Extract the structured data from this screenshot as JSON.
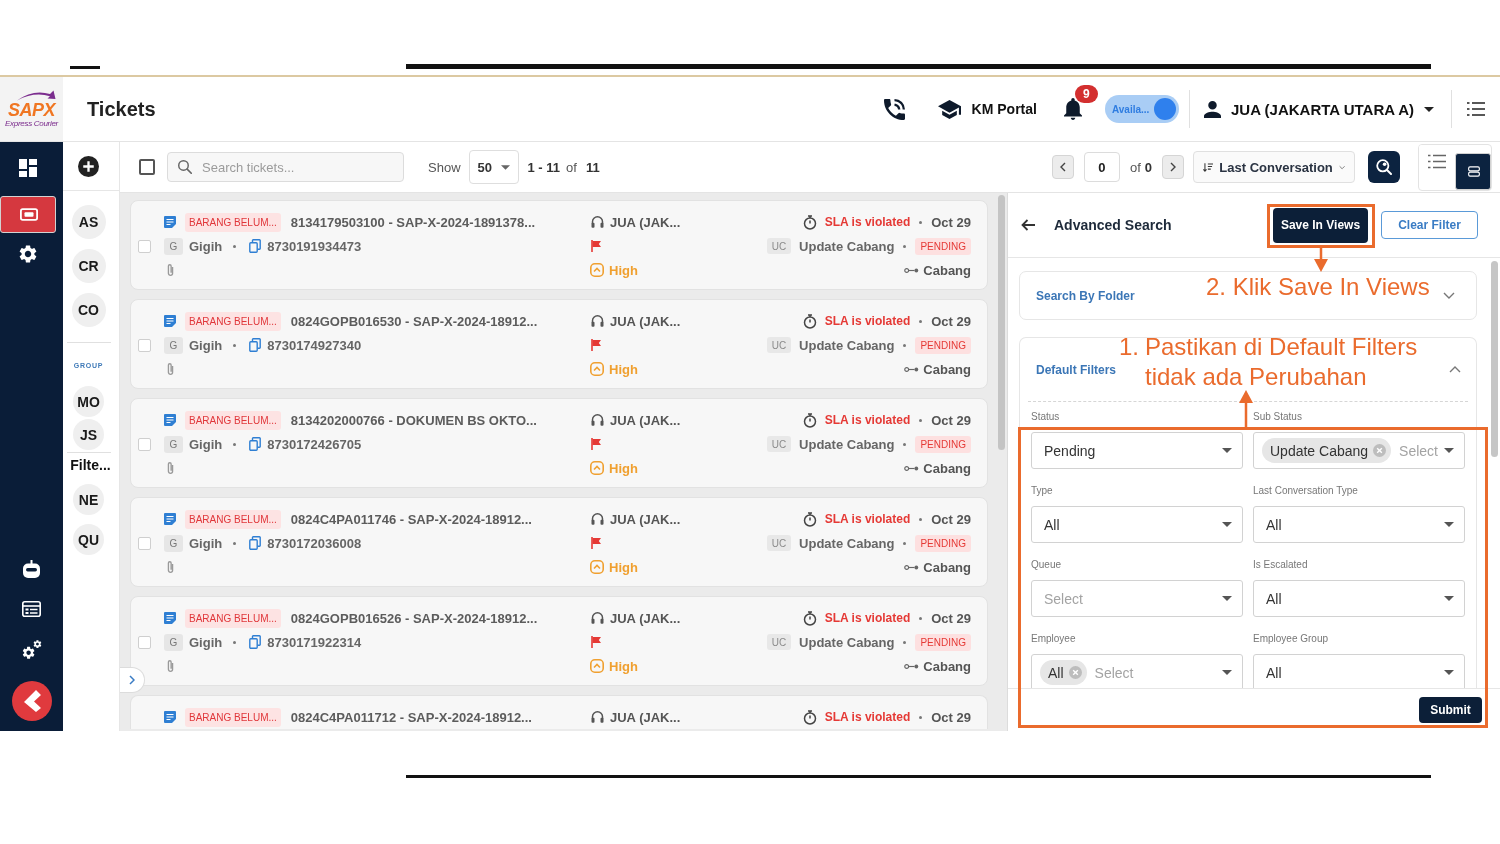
{
  "logo": {
    "name": "SAPX",
    "tagline": "Express Courier"
  },
  "header": {
    "title": "Tickets",
    "km_portal": "KM Portal",
    "notification_count": "9",
    "availability": {
      "label": "Availa...",
      "on": true
    },
    "user": "JUA (JAKARTA UTARA A)"
  },
  "nav": [
    {
      "selected": false
    },
    {
      "selected": true
    },
    {
      "selected": false
    }
  ],
  "views": [
    {
      "kind": "avatar",
      "label": "AS"
    },
    {
      "kind": "avatar",
      "label": "CR"
    },
    {
      "kind": "avatar",
      "label": "CO"
    },
    {
      "kind": "heading",
      "label": "GROUP"
    },
    {
      "kind": "avatar",
      "label": "MO"
    },
    {
      "kind": "avatar",
      "label": "JS"
    },
    {
      "kind": "section",
      "label": "Filte..."
    },
    {
      "kind": "avatar",
      "label": "NE"
    },
    {
      "kind": "avatar",
      "label": "QU"
    }
  ],
  "toolbar": {
    "select_all": {
      "checked": false
    },
    "search": {
      "placeholder": "Search tickets..."
    },
    "show_label": "Show",
    "page_size": "50",
    "range": "1 - 11",
    "of_label": "of",
    "total": "11",
    "page": "0",
    "page_of_label": "of",
    "page_total": "0",
    "sort": "Last Conversation",
    "view_modes": [
      {
        "selected": false
      },
      {
        "selected": true
      }
    ]
  },
  "tickets": [
    {
      "checked": false,
      "tag": "BARANG BELUM...",
      "title": "8134179503100 - SAP-X-2024-1891378...",
      "avatar": "G",
      "user": "Gigih",
      "awb": "8730191934473",
      "agent": "JUA (JAK...",
      "priority": "High",
      "sla": "SLA is violated",
      "date": "Oct 29",
      "status_code": "UC",
      "sub_status": "Update Cabang",
      "status": "PENDING",
      "location": "Cabang"
    },
    {
      "checked": false,
      "tag": "BARANG BELUM...",
      "title": "0824GOPB016530 - SAP-X-2024-18912...",
      "avatar": "G",
      "user": "Gigih",
      "awb": "8730174927340",
      "agent": "JUA (JAK...",
      "priority": "High",
      "sla": "SLA is violated",
      "date": "Oct 29",
      "status_code": "UC",
      "sub_status": "Update Cabang",
      "status": "PENDING",
      "location": "Cabang"
    },
    {
      "checked": false,
      "tag": "BARANG BELUM...",
      "title": "8134202000766 - DOKUMEN BS OKTO...",
      "avatar": "G",
      "user": "Gigih",
      "awb": "8730172426705",
      "agent": "JUA (JAK...",
      "priority": "High",
      "sla": "SLA is violated",
      "date": "Oct 29",
      "status_code": "UC",
      "sub_status": "Update Cabang",
      "status": "PENDING",
      "location": "Cabang"
    },
    {
      "checked": false,
      "tag": "BARANG BELUM...",
      "title": "0824C4PA011746 - SAP-X-2024-18912...",
      "avatar": "G",
      "user": "Gigih",
      "awb": "8730172036008",
      "agent": "JUA (JAK...",
      "priority": "High",
      "sla": "SLA is violated",
      "date": "Oct 29",
      "status_code": "UC",
      "sub_status": "Update Cabang",
      "status": "PENDING",
      "location": "Cabang"
    },
    {
      "checked": false,
      "tag": "BARANG BELUM...",
      "title": "0824GOPB016526 - SAP-X-2024-18912...",
      "avatar": "G",
      "user": "Gigih",
      "awb": "8730171922314",
      "agent": "JUA (JAK...",
      "priority": "High",
      "sla": "SLA is violated",
      "date": "Oct 29",
      "status_code": "UC",
      "sub_status": "Update Cabang",
      "status": "PENDING",
      "location": "Cabang"
    },
    {
      "tag": "BARANG BELUM...",
      "title": "0824C4PA011712 - SAP-X-2024-18912...",
      "agent": "JUA (JAK...",
      "sla": "SLA is violated",
      "date": "Oct 29"
    }
  ],
  "advanced_search": {
    "title": "Advanced Search",
    "save_button": "Save In Views",
    "clear_button": "Clear Filter",
    "sections": [
      {
        "title": "Search By Folder",
        "expanded": false
      },
      {
        "title": "Default Filters",
        "expanded": true,
        "fields": [
          {
            "label": "Status",
            "value": "Pending"
          },
          {
            "label": "Sub Status",
            "chips": [
              "Update Cabang"
            ],
            "placeholder": "Select"
          },
          {
            "label": "Type",
            "value": "All"
          },
          {
            "label": "Last Conversation Type",
            "value": "All"
          },
          {
            "label": "Queue",
            "placeholder": "Select"
          },
          {
            "label": "Is Escalated",
            "value": "All"
          },
          {
            "label": "Employee",
            "chips": [
              "All"
            ],
            "placeholder": "Select"
          },
          {
            "label": "Employee Group",
            "value": "All"
          }
        ]
      }
    ],
    "submit": "Submit"
  },
  "annotations": [
    {
      "text": "2. Klik Save In Views"
    },
    {
      "number": "1.",
      "text": "Pastikan di Default Filters tidak ada Perubahan"
    }
  ]
}
